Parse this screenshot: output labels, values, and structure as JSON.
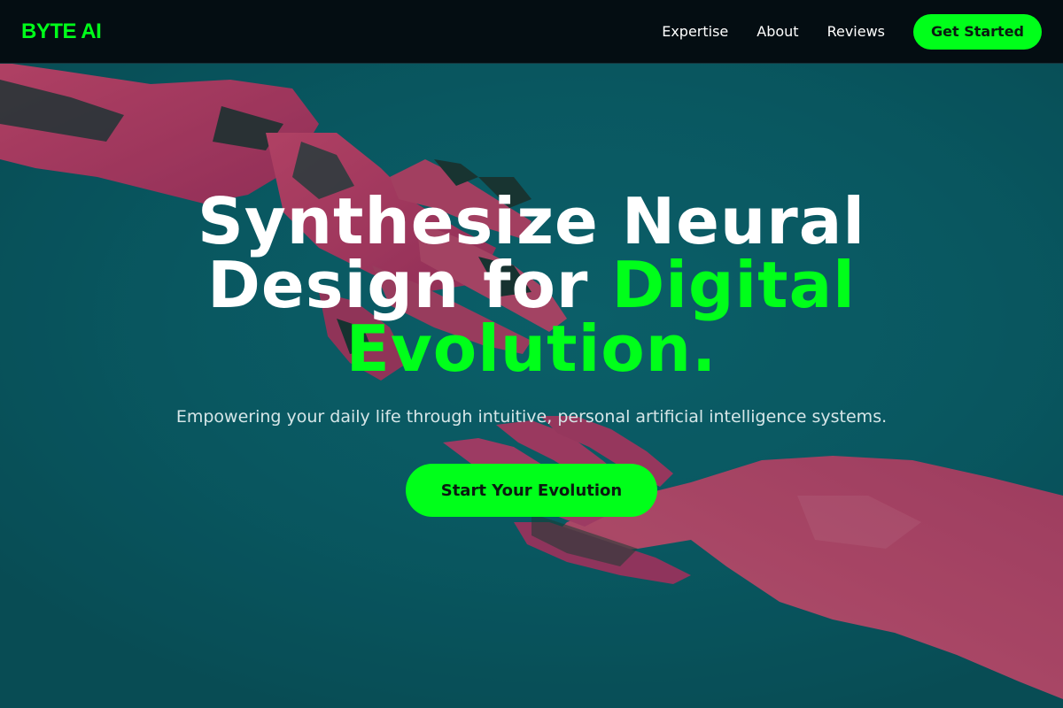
{
  "brand": {
    "logo": "BYTE AI",
    "accent_color": "#00ff1a"
  },
  "nav": {
    "links": [
      "Expertise",
      "About",
      "Reviews"
    ],
    "cta": "Get Started"
  },
  "hero": {
    "headline_line1": "Synthesize Neural",
    "headline_line2_white": "Design for ",
    "headline_line2_accent": "Digital",
    "headline_line3_accent": "Evolution.",
    "subtitle": "Empowering your daily life through intuitive, personal artificial intelligence systems.",
    "cta": "Start Your Evolution",
    "background_image": "robot-hand-reaching-human-hand"
  }
}
